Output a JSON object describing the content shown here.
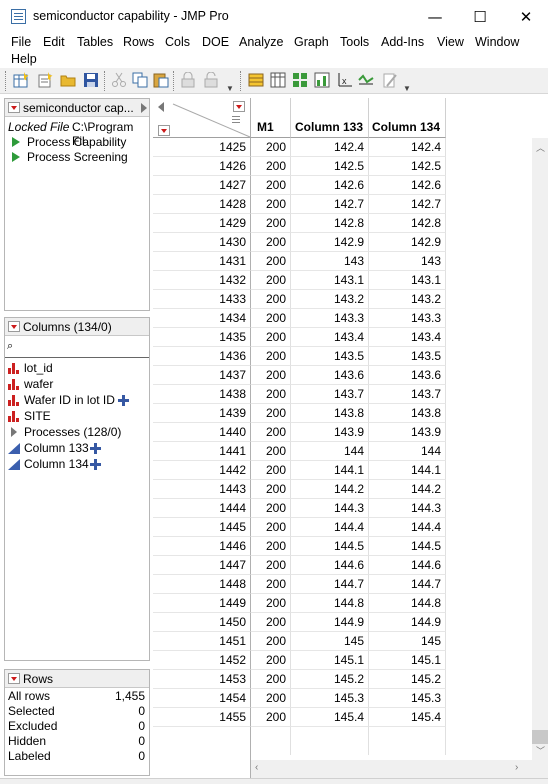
{
  "window": {
    "title": "semiconductor capability - JMP Pro",
    "minimize_glyph": "—",
    "maximize_glyph": "☐",
    "close_glyph": "✕"
  },
  "menu": {
    "items": [
      "File",
      "Edit",
      "Tables",
      "Rows",
      "Cols",
      "DOE",
      "Analyze",
      "Graph",
      "Tools",
      "Add-Ins",
      "View",
      "Window",
      "Help"
    ]
  },
  "toolbar": {
    "icons": [
      "new-table-icon",
      "new-script-icon",
      "open-icon",
      "save-icon",
      "cut-icon",
      "copy-icon",
      "paste-icon",
      "lock-icon",
      "unlock-icon",
      "data-table-icon",
      "columns-viewer-icon",
      "distribution-icon",
      "graph-builder-icon",
      "fit-y-by-x-icon",
      "control-chart-icon",
      "edit-script-icon"
    ]
  },
  "table_panel": {
    "name": "semiconductor cap...",
    "locked_label": "Locked File",
    "locked_path": "C:\\Program Fil",
    "scripts": [
      "Process Capability",
      "Process Screening"
    ]
  },
  "columns_panel": {
    "title": "Columns (134/0)",
    "search_glyph": "⌕",
    "columns": [
      {
        "name": "lot_id",
        "type": "nominal",
        "has_role": false
      },
      {
        "name": "wafer",
        "type": "nominal",
        "has_role": false
      },
      {
        "name": "Wafer ID in lot ID",
        "type": "nominal",
        "has_role": true
      },
      {
        "name": "SITE",
        "type": "nominal",
        "has_role": false
      },
      {
        "name": "Processes (128/0)",
        "type": "group",
        "has_role": false
      },
      {
        "name": "Column 133",
        "type": "continuous",
        "has_role": true
      },
      {
        "name": "Column 134",
        "type": "continuous",
        "has_role": true
      }
    ]
  },
  "rows_panel": {
    "title": "Rows",
    "stats": [
      {
        "label": "All rows",
        "value": "1,455"
      },
      {
        "label": "Selected",
        "value": "0"
      },
      {
        "label": "Excluded",
        "value": "0"
      },
      {
        "label": "Hidden",
        "value": "0"
      },
      {
        "label": "Labeled",
        "value": "0"
      }
    ]
  },
  "grid": {
    "headers": [
      "M1",
      "Column 133",
      "Column 134"
    ],
    "rows": [
      [
        "1425",
        "200",
        "142.4",
        "142.4"
      ],
      [
        "1426",
        "200",
        "142.5",
        "142.5"
      ],
      [
        "1427",
        "200",
        "142.6",
        "142.6"
      ],
      [
        "1428",
        "200",
        "142.7",
        "142.7"
      ],
      [
        "1429",
        "200",
        "142.8",
        "142.8"
      ],
      [
        "1430",
        "200",
        "142.9",
        "142.9"
      ],
      [
        "1431",
        "200",
        "143",
        "143"
      ],
      [
        "1432",
        "200",
        "143.1",
        "143.1"
      ],
      [
        "1433",
        "200",
        "143.2",
        "143.2"
      ],
      [
        "1434",
        "200",
        "143.3",
        "143.3"
      ],
      [
        "1435",
        "200",
        "143.4",
        "143.4"
      ],
      [
        "1436",
        "200",
        "143.5",
        "143.5"
      ],
      [
        "1437",
        "200",
        "143.6",
        "143.6"
      ],
      [
        "1438",
        "200",
        "143.7",
        "143.7"
      ],
      [
        "1439",
        "200",
        "143.8",
        "143.8"
      ],
      [
        "1440",
        "200",
        "143.9",
        "143.9"
      ],
      [
        "1441",
        "200",
        "144",
        "144"
      ],
      [
        "1442",
        "200",
        "144.1",
        "144.1"
      ],
      [
        "1443",
        "200",
        "144.2",
        "144.2"
      ],
      [
        "1444",
        "200",
        "144.3",
        "144.3"
      ],
      [
        "1445",
        "200",
        "144.4",
        "144.4"
      ],
      [
        "1446",
        "200",
        "144.5",
        "144.5"
      ],
      [
        "1447",
        "200",
        "144.6",
        "144.6"
      ],
      [
        "1448",
        "200",
        "144.7",
        "144.7"
      ],
      [
        "1449",
        "200",
        "144.8",
        "144.8"
      ],
      [
        "1450",
        "200",
        "144.9",
        "144.9"
      ],
      [
        "1451",
        "200",
        "145",
        "145"
      ],
      [
        "1452",
        "200",
        "145.1",
        "145.1"
      ],
      [
        "1453",
        "200",
        "145.2",
        "145.2"
      ],
      [
        "1454",
        "200",
        "145.3",
        "145.3"
      ],
      [
        "1455",
        "200",
        "145.4",
        "145.4"
      ]
    ]
  },
  "colors": {
    "accent_red": "#cc1a1a",
    "script_green": "#2e9b3a",
    "continuous_blue": "#3b5fae",
    "panel_header": "#efefef"
  }
}
